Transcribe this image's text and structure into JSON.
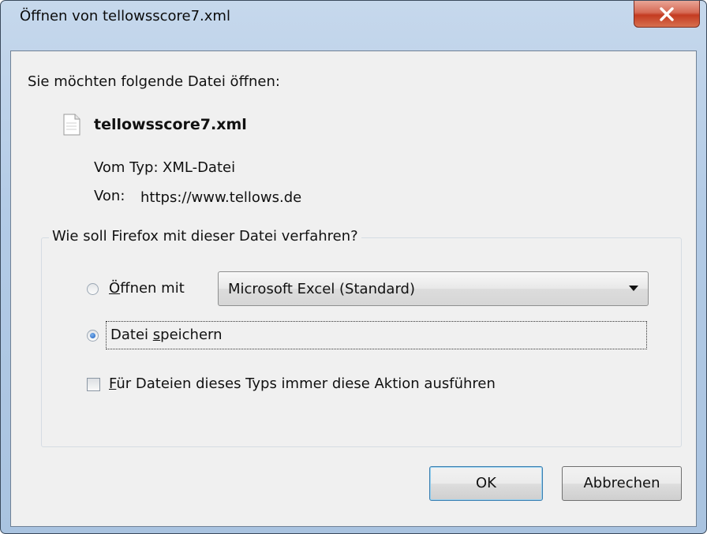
{
  "window": {
    "title": "Öffnen von tellowsscore7.xml",
    "close_icon": "close-icon"
  },
  "dialog": {
    "intro": "Sie möchten folgende Datei öffnen:",
    "file_icon": "document-icon",
    "filename": "tellowsscore7.xml",
    "type_label": "Vom Typ:",
    "type_value": "XML-Datei",
    "from_label": "Von:",
    "from_value": "https://www.tellows.de",
    "group_legend": "Wie soll Firefox mit dieser Datei verfahren?",
    "open_with": {
      "mnemonic": "Ö",
      "rest": "ffnen mit",
      "checked": false
    },
    "app_select": {
      "value": "Microsoft Excel (Standard)"
    },
    "save_file": {
      "before": "Datei ",
      "mnemonic": "s",
      "rest": "peichern",
      "checked": true
    },
    "always_action": {
      "mnemonic": "F",
      "rest": "ür Dateien dieses Typs immer diese Aktion ausführen",
      "checked": false
    }
  },
  "buttons": {
    "ok": "OK",
    "cancel": "Abbrechen"
  },
  "colors": {
    "titlebar": "#b3cbe6",
    "close_button": "#c43b21",
    "dialog_bg": "#f0f0f0",
    "default_button_border": "#3c7fb1"
  }
}
